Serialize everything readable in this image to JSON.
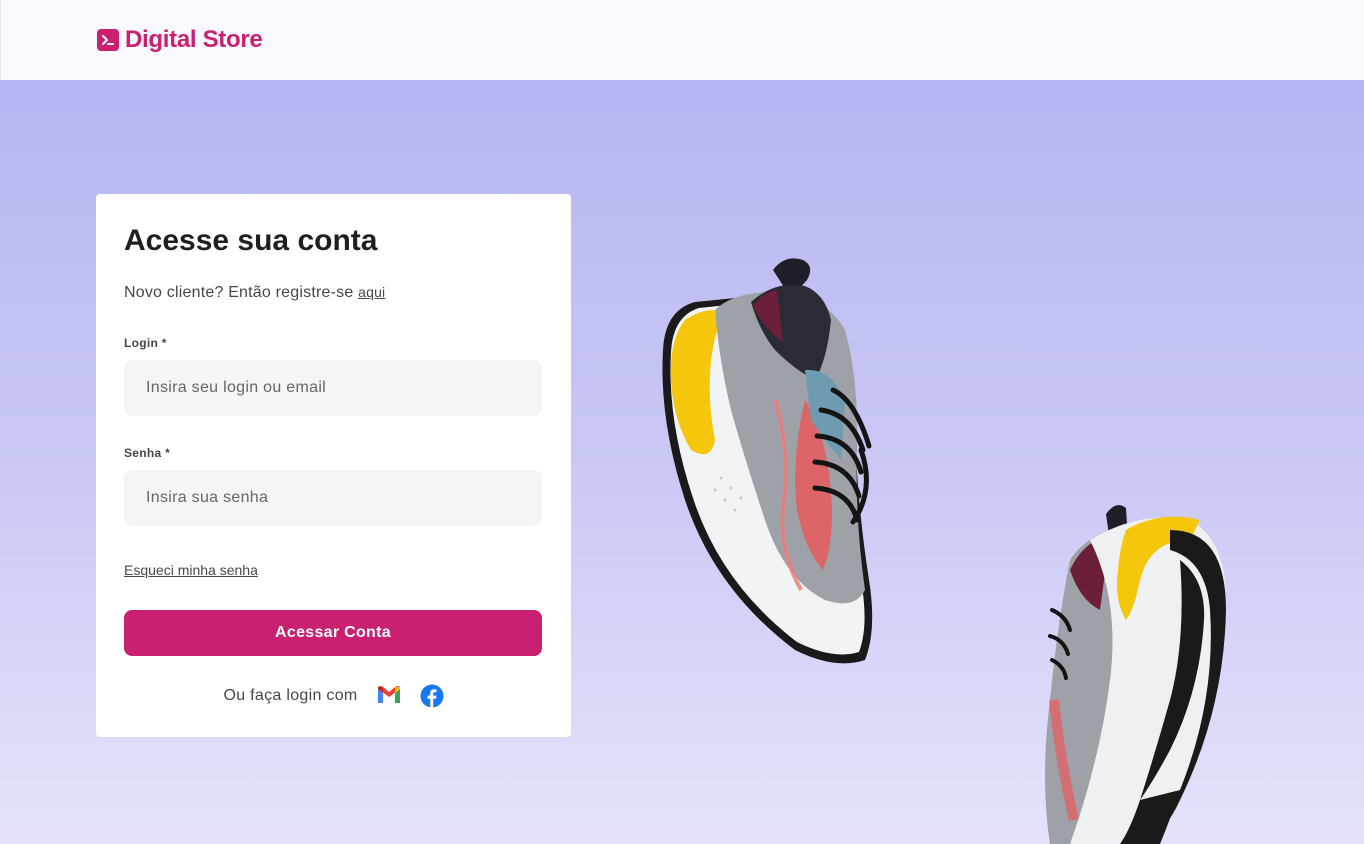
{
  "header": {
    "brand": "Digital Store"
  },
  "login_card": {
    "title": "Acesse sua conta",
    "subtitle": "Novo cliente? Então registre-se",
    "register_link": "aqui",
    "login_label": "Login *",
    "login_placeholder": "Insira seu login ou email",
    "password_label": "Senha *",
    "password_placeholder": "Insira sua senha",
    "forgot_link": "Esqueci minha senha",
    "submit_label": "Acessar Conta",
    "social_text": "Ou faça login com"
  },
  "colors": {
    "brand": "#c92071",
    "background_top": "#b5b6f2",
    "background_bottom": "#e4e3fa",
    "text": "#474747",
    "title": "#1f1f1f",
    "input_bg": "#f5f5f5"
  },
  "icons": {
    "logo": "terminal-icon",
    "gmail": "gmail-icon",
    "facebook": "facebook-icon"
  }
}
